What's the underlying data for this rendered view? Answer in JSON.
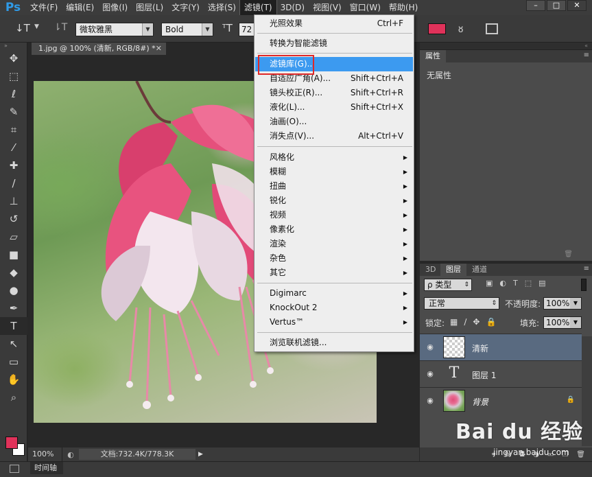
{
  "app": {
    "logo": "Ps"
  },
  "menubar": {
    "items": [
      "文件(F)",
      "编辑(E)",
      "图像(I)",
      "图层(L)",
      "文字(Y)",
      "选择(S)",
      "滤镜(T)",
      "3D(D)",
      "视图(V)",
      "窗口(W)",
      "帮助(H)"
    ],
    "active_index": 6
  },
  "window_controls": {
    "minimize": "–",
    "maximize": "□",
    "close": "✕"
  },
  "options": {
    "tool_icon": "↓T",
    "font_family": "微软雅黑",
    "font_style": "Bold",
    "font_size": "72",
    "text_color": "#e0325a"
  },
  "document": {
    "tab_title": "1.jpg @ 100% (清新, RGB/8#) *",
    "zoom": "100%",
    "doc_info": "文档:732.4K/778.3K"
  },
  "timeline": {
    "label": "时间轴"
  },
  "filter_menu": {
    "items": [
      {
        "label": "光照效果",
        "shortcut": "Ctrl+F"
      },
      {
        "label": "转换为智能滤镜",
        "shortcut": ""
      },
      {
        "label": "滤镜库(G)...",
        "shortcut": "",
        "highlighted": true
      },
      {
        "label": "自适应广角(A)...",
        "shortcut": "Shift+Ctrl+A"
      },
      {
        "label": "镜头校正(R)...",
        "shortcut": "Shift+Ctrl+R"
      },
      {
        "label": "液化(L)...",
        "shortcut": "Shift+Ctrl+X"
      },
      {
        "label": "油画(O)...",
        "shortcut": ""
      },
      {
        "label": "消失点(V)...",
        "shortcut": "Alt+Ctrl+V"
      },
      {
        "label": "风格化",
        "submenu": true
      },
      {
        "label": "模糊",
        "submenu": true
      },
      {
        "label": "扭曲",
        "submenu": true
      },
      {
        "label": "锐化",
        "submenu": true
      },
      {
        "label": "视频",
        "submenu": true
      },
      {
        "label": "像素化",
        "submenu": true
      },
      {
        "label": "渲染",
        "submenu": true
      },
      {
        "label": "杂色",
        "submenu": true
      },
      {
        "label": "其它",
        "submenu": true
      },
      {
        "label": "Digimarc",
        "submenu": true
      },
      {
        "label": "KnockOut 2",
        "submenu": true
      },
      {
        "label": "Vertus™",
        "submenu": true
      },
      {
        "label": "浏览联机滤镜..."
      }
    ],
    "submenu_arrow": "▶"
  },
  "properties_panel": {
    "tab": "属性",
    "empty_text": "无属性",
    "menu_icon": "≡"
  },
  "layers_panel": {
    "tabs": [
      "3D",
      "图层",
      "通道"
    ],
    "active_tab": 1,
    "filter_label": "ρ 类型",
    "blend_mode": "正常",
    "opacity_label": "不透明度:",
    "opacity_value": "100%",
    "lock_label": "锁定:",
    "fill_label": "填充:",
    "fill_value": "100%",
    "layers": [
      {
        "name": "清新",
        "kind": "empty",
        "selected": true
      },
      {
        "name": "图层 1",
        "kind": "text",
        "selected": false
      },
      {
        "name": "背景",
        "kind": "image",
        "selected": false,
        "locked": true
      }
    ]
  },
  "watermark": {
    "brand": "Bai du 经验",
    "url": "jingyan.baidu.com"
  }
}
